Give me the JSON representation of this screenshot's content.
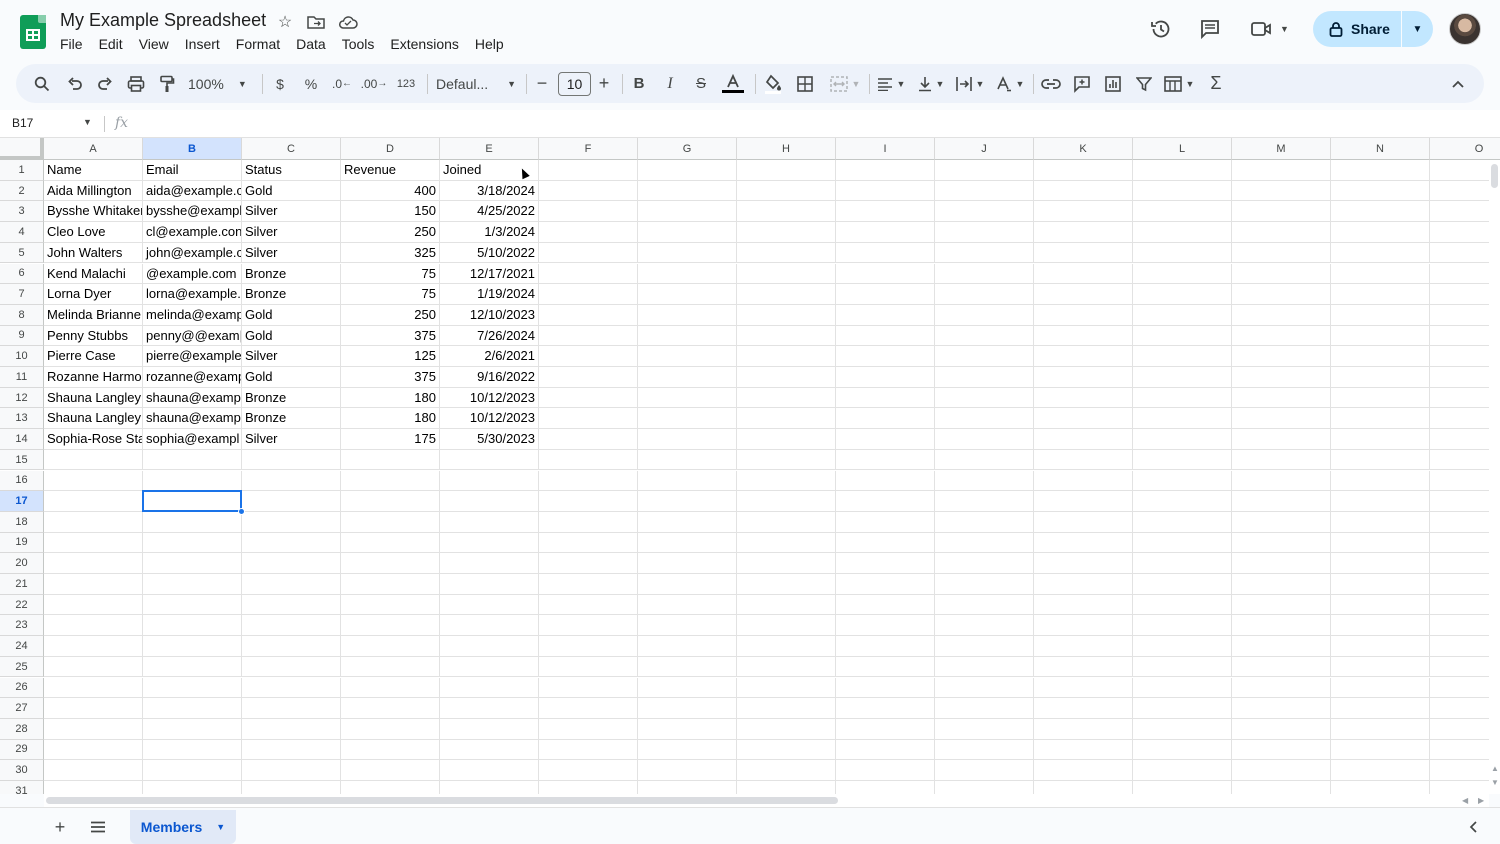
{
  "app": {
    "title": "My Example Spreadsheet",
    "menus": [
      "File",
      "Edit",
      "View",
      "Insert",
      "Format",
      "Data",
      "Tools",
      "Extensions",
      "Help"
    ],
    "share_label": "Share"
  },
  "toolbar": {
    "zoom": "100%",
    "currency": "$",
    "percent": "%",
    "dec_decrease": ".0",
    "dec_increase": ".00",
    "number_format": "123",
    "font": "Defaul...",
    "font_size": "10",
    "minus": "−",
    "plus": "+"
  },
  "formula_bar": {
    "cell_ref": "B17",
    "fx": "fx",
    "value": ""
  },
  "grid": {
    "columns": [
      "A",
      "B",
      "C",
      "D",
      "E",
      "F",
      "G",
      "H",
      "I",
      "J",
      "K",
      "L",
      "M",
      "N",
      "O"
    ],
    "selected_column": "B",
    "selected_row": 17,
    "visible_rows": 31,
    "rows": [
      [
        "Name",
        "Email",
        "Status",
        "Revenue",
        "Joined"
      ],
      [
        "Aida Millington",
        "aida@example.c",
        "Gold",
        "400",
        "3/18/2024"
      ],
      [
        "Bysshe Whitaker",
        "bysshe@exampl",
        "Silver",
        "150",
        "4/25/2022"
      ],
      [
        "Cleo Love",
        "cl@example.con",
        "Silver",
        "250",
        "1/3/2024"
      ],
      [
        "John Walters",
        "john@example.c",
        "Silver",
        "325",
        "5/10/2022"
      ],
      [
        "Kend Malachi",
        "@example.com",
        "Bronze",
        "75",
        "12/17/2021"
      ],
      [
        "Lorna Dyer",
        "lorna@example.",
        "Bronze",
        "75",
        "1/19/2024"
      ],
      [
        "Melinda Brianne",
        "melinda@examp",
        "Gold",
        "250",
        "12/10/2023"
      ],
      [
        "Penny Stubbs",
        "penny@@exam|",
        "Gold",
        "375",
        "7/26/2024"
      ],
      [
        "Pierre Case",
        "pierre@example",
        "Silver",
        "125",
        "2/6/2021"
      ],
      [
        "Rozanne Harmo",
        "rozanne@examp",
        "Gold",
        "375",
        "9/16/2022"
      ],
      [
        "Shauna Langley",
        "shauna@examp",
        "Bronze",
        "180",
        "10/12/2023"
      ],
      [
        "Shauna Langley",
        "shauna@examp",
        "Bronze",
        "180",
        "10/12/2023"
      ],
      [
        "Sophia-Rose Sta",
        "sophia@exampl",
        "Silver",
        "175",
        "5/30/2023"
      ]
    ]
  },
  "sheets": {
    "active": "Members"
  },
  "colors": {
    "accent": "#0b57d0",
    "share_bg": "#c2e7ff",
    "toolbar_bg": "#edf2fa",
    "sheets_green": "#0f9d58",
    "selection": "#1a73e8"
  }
}
